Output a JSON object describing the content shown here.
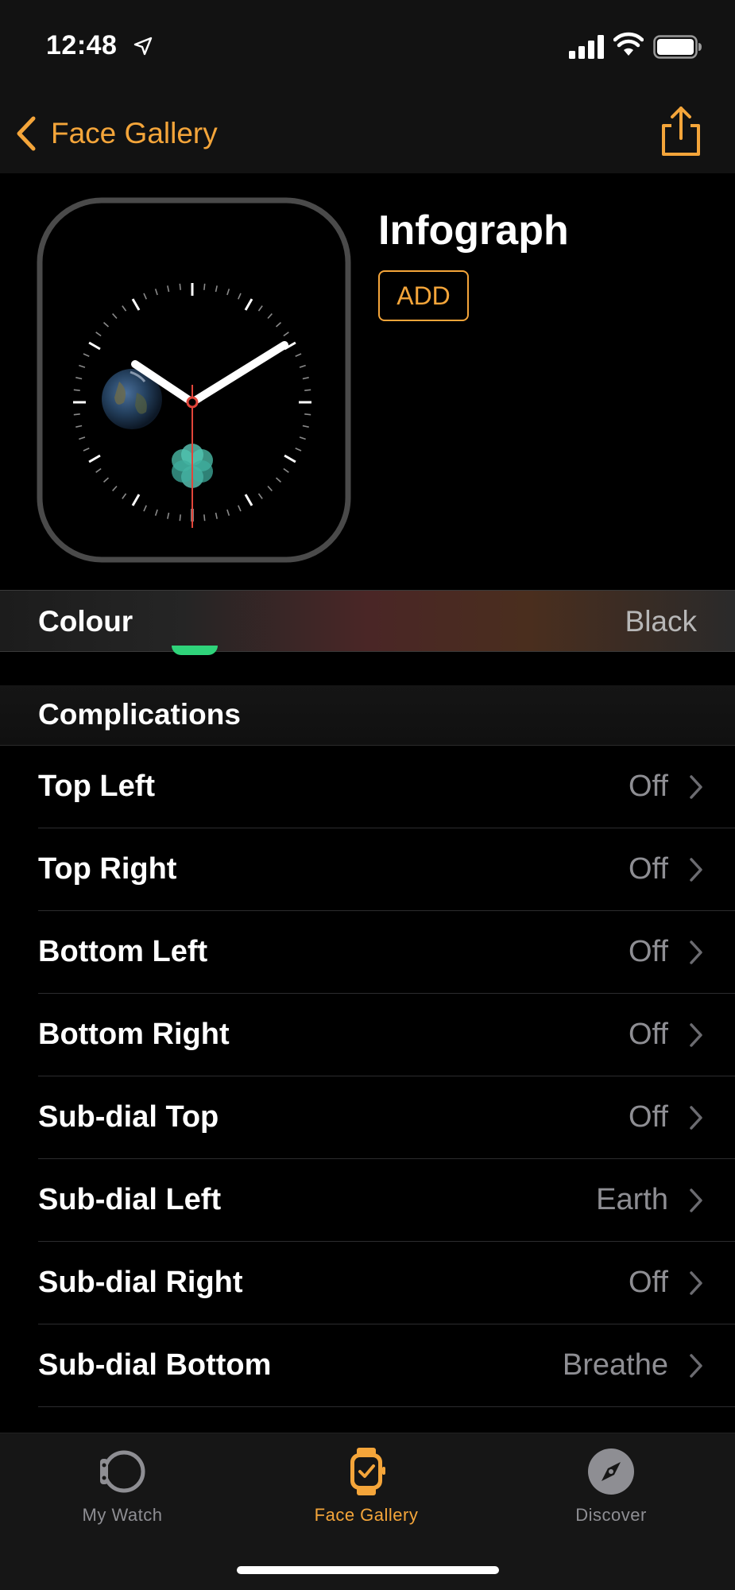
{
  "status_bar": {
    "time": "12:48"
  },
  "nav": {
    "back_label": "Face Gallery"
  },
  "face": {
    "title": "Infograph",
    "add_label": "ADD"
  },
  "colour": {
    "label": "Colour",
    "value": "Black"
  },
  "complications": {
    "header": "Complications",
    "items": [
      {
        "label": "Top Left",
        "value": "Off"
      },
      {
        "label": "Top Right",
        "value": "Off"
      },
      {
        "label": "Bottom Left",
        "value": "Off"
      },
      {
        "label": "Bottom Right",
        "value": "Off"
      },
      {
        "label": "Sub-dial Top",
        "value": "Off"
      },
      {
        "label": "Sub-dial Left",
        "value": "Earth"
      },
      {
        "label": "Sub-dial Right",
        "value": "Off"
      },
      {
        "label": "Sub-dial Bottom",
        "value": "Breathe"
      }
    ]
  },
  "tabs": [
    {
      "label": "My Watch",
      "icon": "watch-outline-icon"
    },
    {
      "label": "Face Gallery",
      "icon": "watch-face-icon",
      "active": true
    },
    {
      "label": "Discover",
      "icon": "compass-icon"
    }
  ],
  "colors": {
    "accent": "#f4a53a",
    "background": "#000000",
    "secondary_text": "#8e8e93"
  }
}
